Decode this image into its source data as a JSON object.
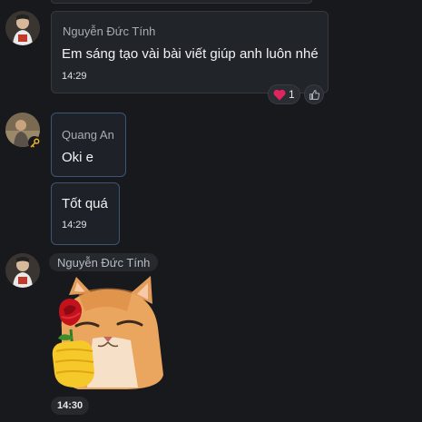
{
  "messages": [
    {
      "sender": "Nguyễn Đức Tính",
      "text": "Em sáng tạo vài bài viết giúp anh luôn nhé",
      "time": "14:29",
      "reaction": {
        "icon": "heart-icon",
        "count": "1"
      }
    },
    {
      "sender": "Quang An",
      "text": "Oki e",
      "time": ""
    },
    {
      "sender": "",
      "text": "Tốt quá",
      "time": "14:29"
    },
    {
      "sender": "Nguyễn Đức Tính",
      "sticker": "cat-holding-rose-sticker",
      "time": "14:30"
    }
  ],
  "colors": {
    "background": "#17191d",
    "bubble": "#212429",
    "highlight_border": "#3c5573",
    "reaction_heart": "#e0245e"
  }
}
